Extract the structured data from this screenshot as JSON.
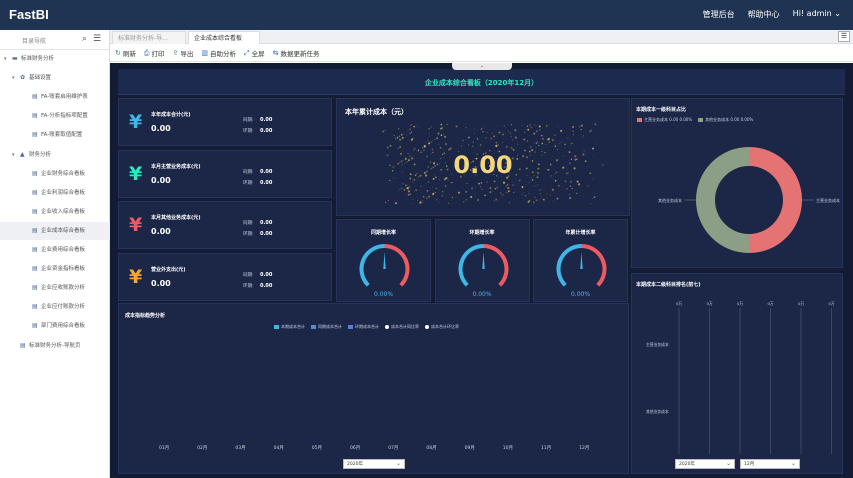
{
  "header": {
    "brand": "FastBI",
    "nav": [
      "管理后台",
      "帮助中心"
    ],
    "greeting": "Hi!",
    "user": "admin",
    "user_caret": "⌄"
  },
  "sidebar": {
    "title": "目录导航",
    "items": [
      {
        "label": "标准财务分析",
        "level": 0,
        "arrow": "▾",
        "icon": "▬"
      },
      {
        "label": "基础设置",
        "level": 1,
        "arrow": "▾",
        "icon": "✿"
      },
      {
        "label": "FA-账套启用维护表",
        "level": 2,
        "icon": "▤"
      },
      {
        "label": "FA-分析指标项配置",
        "level": 2,
        "icon": "▤"
      },
      {
        "label": "FA-账套取值配置",
        "level": 2,
        "icon": "▤"
      },
      {
        "label": "财务分析",
        "level": 1,
        "arrow": "▾",
        "icon": "▲"
      },
      {
        "label": "企业财务综合看板",
        "level": 2,
        "icon": "▤"
      },
      {
        "label": "企业利润综合看板",
        "level": 2,
        "icon": "▤"
      },
      {
        "label": "企业收入综合看板",
        "level": 2,
        "icon": "▤"
      },
      {
        "label": "企业成本综合看板",
        "level": 2,
        "icon": "▤",
        "selected": true
      },
      {
        "label": "企业费用综合看板",
        "level": 2,
        "icon": "▤"
      },
      {
        "label": "企业资金指标看板",
        "level": 2,
        "icon": "▤"
      },
      {
        "label": "企业应收账款分析",
        "level": 2,
        "icon": "▤"
      },
      {
        "label": "企业应付账款分析",
        "level": 2,
        "icon": "▤"
      },
      {
        "label": "部门费用综合看板",
        "level": 2,
        "icon": "▤"
      },
      {
        "label": "标准财务分析-导航页",
        "level": 1,
        "icon": "▤"
      }
    ]
  },
  "tabs": [
    {
      "label": "标准财务分析-导..."
    },
    {
      "label": "企业成本综合看板",
      "active": true
    }
  ],
  "toolbar": [
    {
      "icon": "↻",
      "label": "刷新"
    },
    {
      "icon": "⎙",
      "label": "打印"
    },
    {
      "icon": "⇪",
      "label": "导出"
    },
    {
      "icon": "▥",
      "label": "自助分析"
    },
    {
      "icon": "⤢",
      "label": "全屏"
    },
    {
      "icon": "⇆",
      "label": "数据更新任务"
    }
  ],
  "dashboard": {
    "title": "企业成本综合看板（2020年12月）",
    "kpis": [
      {
        "symbol": "¥",
        "color": "#3fb6e6",
        "name": "本年成本合计(元)",
        "value": "0.00",
        "l1": "同期:",
        "v1": "0.00",
        "l2": "环期:",
        "v2": "0.00"
      },
      {
        "symbol": "¥",
        "color": "#2ee8c0",
        "name": "本月主营业务成本(元)",
        "value": "0.00",
        "l1": "同期:",
        "v1": "0.00",
        "l2": "环期:",
        "v2": "0.00"
      },
      {
        "symbol": "¥",
        "color": "#ee5a62",
        "name": "本月其他业务成本(元)",
        "value": "0.00",
        "l1": "同期:",
        "v1": "0.00",
        "l2": "环期:",
        "v2": "0.00"
      },
      {
        "symbol": "¥",
        "color": "#f1a63a",
        "name": "营业外支出(元)",
        "value": "0.00",
        "l1": "同期:",
        "v1": "0.00",
        "l2": "环期:",
        "v2": "0.00"
      }
    ],
    "annual": {
      "title": "本年累计成本（元）",
      "value": "0.00"
    },
    "gauges": [
      {
        "title": "同期增长率",
        "value": "0.00%",
        "ratio": 0
      },
      {
        "title": "环期增长率",
        "value": "0.00%",
        "ratio": 0
      },
      {
        "title": "年累计增长率",
        "value": "0.00%",
        "ratio": 0
      }
    ],
    "pie": {
      "title": "本期成本一级科目占比",
      "legend": [
        {
          "label": "主营业务成本 0.00 0.00%",
          "color": "#e57373"
        },
        {
          "label": "其他业务成本 0.00 0.00%",
          "color": "#8c9e86"
        }
      ],
      "left_label": "其他业务成本",
      "right_label": "主营业务成本"
    },
    "trend": {
      "title": "成本指标趋势分析",
      "legend": [
        {
          "label": "本期成本合计",
          "color": "#3fb6e6"
        },
        {
          "label": "同期成本合计",
          "color": "#4a90d9"
        },
        {
          "label": "环期成本合计",
          "color": "#5a7ee6"
        },
        {
          "label": "成本合计同比率",
          "color": "#ffffff"
        },
        {
          "label": "成本合计环比率",
          "color": "#ffffff"
        }
      ],
      "months": [
        "01月",
        "02月",
        "03月",
        "04月",
        "05月",
        "06月",
        "07月",
        "08月",
        "09月",
        "10月",
        "11月",
        "12月"
      ],
      "year": "2020年"
    },
    "rank": {
      "title": "本期成本二级科目排名(前七)",
      "ticks": [
        "0万",
        "0万",
        "0万",
        "0万",
        "0万",
        "0万"
      ],
      "rows": [
        "主营业务成本",
        "其他业务成本"
      ],
      "year": "2020年",
      "month": "12月"
    }
  }
}
